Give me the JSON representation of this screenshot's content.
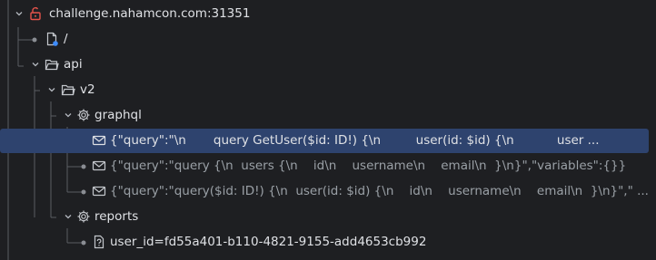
{
  "tree": {
    "root": {
      "label": "challenge.nahamcon.com:31351",
      "icon": "unlocked-host-icon"
    },
    "slash": {
      "label": "/",
      "icon": "file-icon"
    },
    "api": {
      "label": "api",
      "icon": "folder-icon"
    },
    "v2": {
      "label": "v2",
      "icon": "folder-icon"
    },
    "graphql": {
      "label": "graphql",
      "icon": "gear-icon"
    },
    "requests": [
      {
        "label": "{\"query\":\"\\n       query GetUser($id: ID!) {\\n         user(id: $id) {\\n           user ...",
        "icon": "envelope-icon",
        "selected": true
      },
      {
        "label": "{\"query\":\"query {\\n  users {\\n    id\\n    username\\n    email\\n  }\\n}\",\"variables\":{}}",
        "icon": "envelope-icon",
        "selected": false
      },
      {
        "label": "{\"query\":\"query($id: ID!) {\\n  user(id: $id) {\\n    id\\n    username\\n    email\\n  }\\n}\",\" ...",
        "icon": "envelope-icon",
        "selected": false
      }
    ],
    "reports": {
      "label": "reports",
      "icon": "gear-icon"
    },
    "report_item": {
      "label": "user_id=fd55a401-b110-4821-9155-add4653cb992",
      "icon": "unknown-file-icon"
    }
  },
  "colors": {
    "background": "#1e1f22",
    "selection": "#2e436e",
    "text": "#dfe1e5",
    "lock": "#e5534b",
    "accent_dot": "#3d8bfd",
    "lines": "#5a5d63"
  }
}
